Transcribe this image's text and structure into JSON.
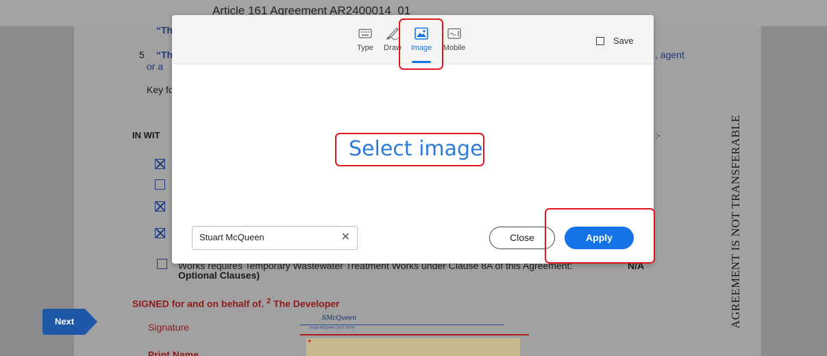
{
  "document": {
    "header": "Article 161 Agreement AR2400014_01",
    "line_quote_top": "“Th",
    "item5_num": "5",
    "item5_text": "“Th",
    "item5_cont": "or a",
    "item5_right": ", agent",
    "key_text": "Key fo",
    "witness_text": "IN WIT",
    "witness_right": ":-",
    "works_line1": "Works requires Temporary Wastewater Treatment Works under Clause 8A of this Agreement:",
    "works_na": "N/A",
    "works_line2": "Optional Clauses)",
    "signed_text": "SIGNED for and on behalf of.",
    "signed_sup": "2",
    "signed_party": "The Developer",
    "signature_label": "Signature",
    "signature_script": "SMcQueen",
    "signature_small": "Stuart McQueen   (Jul 9, 2024)",
    "print_name_label": "Print Name",
    "vertical_text": "AGREEMENT IS NOT TRANSFERABLE",
    "checkboxes": [
      true,
      false,
      true,
      true,
      false
    ]
  },
  "next_tab": {
    "label": "Next"
  },
  "modal": {
    "tabs": [
      {
        "label": "Type",
        "icon": "keyboard-icon",
        "active": false
      },
      {
        "label": "Draw",
        "icon": "pen-icon",
        "active": false
      },
      {
        "label": "Image",
        "icon": "image-icon",
        "active": true
      },
      {
        "label": "Mobile",
        "icon": "mobile-icon",
        "active": false
      }
    ],
    "save_label": "Save",
    "save_checked": false,
    "select_image_label": "Select image",
    "name_value": "Stuart McQueen",
    "clear_icon": "close-icon",
    "close_label": "Close",
    "apply_label": "Apply"
  },
  "colors": {
    "accent": "#1473e6",
    "highlight": "#e1141c",
    "doc_blue": "#1e3a7a",
    "doc_red": "#8e1a1a"
  }
}
